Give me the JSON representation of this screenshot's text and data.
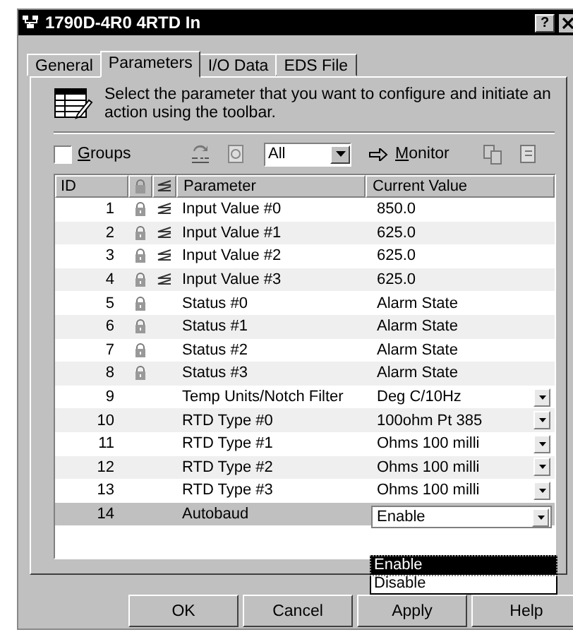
{
  "window": {
    "title": "1790D-4R0 4RTD In",
    "help_button": "?"
  },
  "tabs": [
    {
      "label": "General",
      "selected": false
    },
    {
      "label": "Parameters",
      "selected": true
    },
    {
      "label": "I/O Data",
      "selected": false
    },
    {
      "label": "EDS File",
      "selected": false
    }
  ],
  "description": "Select the parameter that you want to configure and initiate an action using the toolbar.",
  "toolbar": {
    "groups": {
      "label": "Groups",
      "checked": false
    },
    "filter": "All",
    "monitor": "Monitor"
  },
  "table": {
    "columns": [
      "ID",
      "Parameter",
      "Current Value"
    ],
    "rows": [
      {
        "id": "1",
        "parameter": "Input Value #0",
        "value": "850.0",
        "locked": true,
        "monitored": true,
        "kind": "text",
        "selected": false
      },
      {
        "id": "2",
        "parameter": "Input Value #1",
        "value": "625.0",
        "locked": true,
        "monitored": true,
        "kind": "text",
        "selected": false
      },
      {
        "id": "3",
        "parameter": "Input Value #2",
        "value": "625.0",
        "locked": true,
        "monitored": true,
        "kind": "text",
        "selected": false
      },
      {
        "id": "4",
        "parameter": "Input Value #3",
        "value": "625.0",
        "locked": true,
        "monitored": true,
        "kind": "text",
        "selected": false
      },
      {
        "id": "5",
        "parameter": "Status #0",
        "value": "Alarm State",
        "locked": true,
        "monitored": false,
        "kind": "text",
        "selected": false
      },
      {
        "id": "6",
        "parameter": "Status #1",
        "value": "Alarm State",
        "locked": true,
        "monitored": false,
        "kind": "text",
        "selected": false
      },
      {
        "id": "7",
        "parameter": "Status #2",
        "value": "Alarm State",
        "locked": true,
        "monitored": false,
        "kind": "text",
        "selected": false
      },
      {
        "id": "8",
        "parameter": "Status #3",
        "value": "Alarm State",
        "locked": true,
        "monitored": false,
        "kind": "text",
        "selected": false
      },
      {
        "id": "9",
        "parameter": "Temp Units/Notch Filter",
        "value": "Deg C/10Hz",
        "locked": false,
        "monitored": false,
        "kind": "dropdown",
        "selected": false
      },
      {
        "id": "10",
        "parameter": "RTD Type #0",
        "value": "100ohm Pt 385",
        "locked": false,
        "monitored": false,
        "kind": "dropdown",
        "selected": false
      },
      {
        "id": "11",
        "parameter": "RTD Type #1",
        "value": "Ohms 100 milli",
        "locked": false,
        "monitored": false,
        "kind": "dropdown",
        "selected": false
      },
      {
        "id": "12",
        "parameter": "RTD Type #2",
        "value": "Ohms 100 milli",
        "locked": false,
        "monitored": false,
        "kind": "dropdown",
        "selected": false
      },
      {
        "id": "13",
        "parameter": "RTD Type #3",
        "value": "Ohms 100 milli",
        "locked": false,
        "monitored": false,
        "kind": "dropdown",
        "selected": false
      },
      {
        "id": "14",
        "parameter": "Autobaud",
        "value": "Enable",
        "locked": false,
        "monitored": false,
        "kind": "combo",
        "selected": true
      }
    ]
  },
  "dropdown_options": [
    {
      "label": "Enable",
      "selected": true
    },
    {
      "label": "Disable",
      "selected": false
    }
  ],
  "buttons": [
    "OK",
    "Cancel",
    "Apply",
    "Help"
  ]
}
